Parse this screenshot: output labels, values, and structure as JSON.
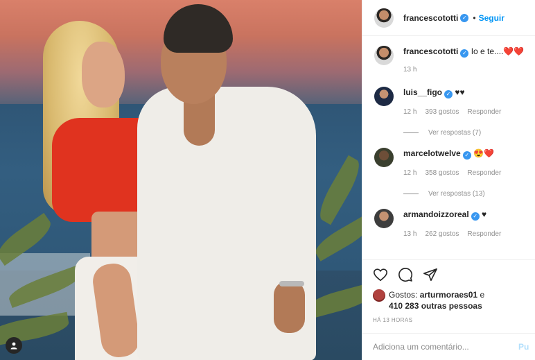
{
  "post": {
    "author": "francescototti",
    "follow_label": "Seguir",
    "dot": "•",
    "caption_author": "francescototti",
    "caption_text": "Io e te....",
    "caption_hearts": "❤️❤️",
    "caption_time": "13 h"
  },
  "comments": [
    {
      "user": "luis__figo",
      "text": "♥♥",
      "time": "12 h",
      "likes": "393 gostos",
      "reply": "Responder",
      "view_replies": "Ver respostas (7)"
    },
    {
      "user": "marcelotwelve",
      "text": "😍❤️",
      "time": "12 h",
      "likes": "358 gostos",
      "reply": "Responder",
      "view_replies": "Ver respostas (13)"
    },
    {
      "user": "armandoizzoreal",
      "text": "♥",
      "time": "13 h",
      "likes": "262 gostos",
      "reply": "Responder"
    }
  ],
  "engagement": {
    "likes_prefix": "Gostos:",
    "likes_user": "arturmoraes01",
    "likes_joiner": "e",
    "likes_others": "410 283 outras pessoas",
    "posted_time": "HÁ 13 HORAS"
  },
  "composer": {
    "placeholder": "Adiciona um comentário...",
    "publish_label": "Pu"
  },
  "icons": [
    "heart-icon",
    "comment-icon",
    "share-icon",
    "verified-icon",
    "user-icon"
  ],
  "colors": {
    "accent": "#0095f6",
    "verified": "#3897f0",
    "heart": "#ed1d2c",
    "muted": "#8e8e8e"
  }
}
